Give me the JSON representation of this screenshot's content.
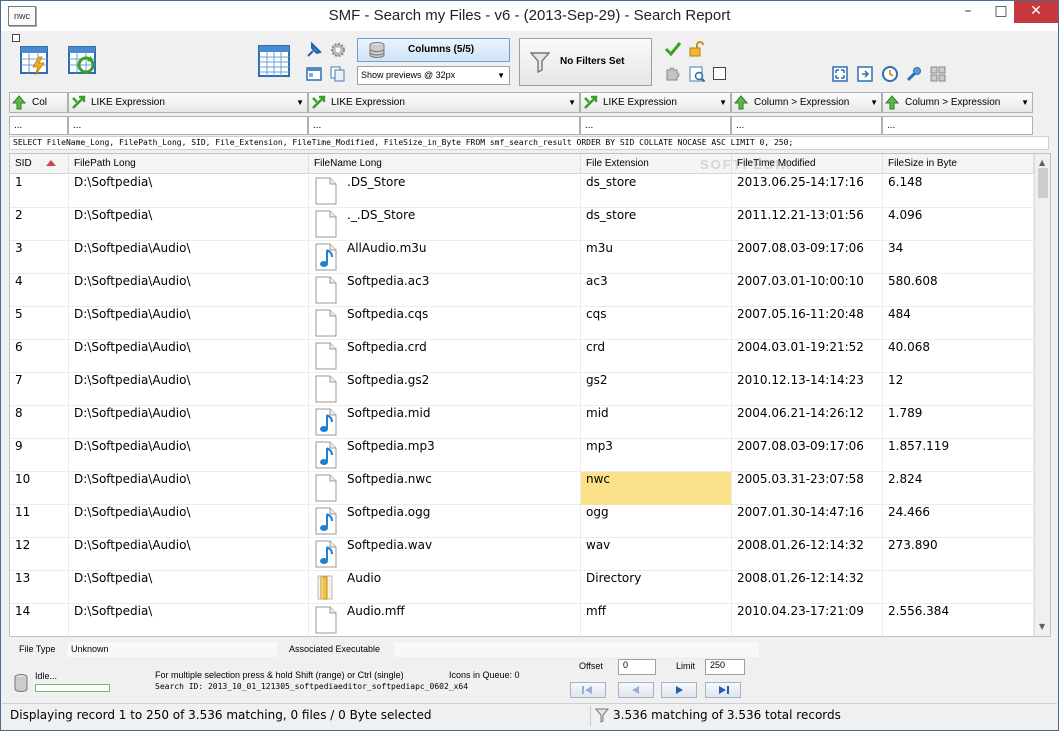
{
  "window": {
    "title": "SMF - Search my Files - v6 - (2013-Sep-29) - Search Report",
    "app_icon_label": "nwc",
    "minimize": "–",
    "maximize": "□",
    "close": "✕"
  },
  "toolbar": {
    "columns_label": "Columns (5/5)",
    "preview_select": "Show previews @ 32px",
    "filter_label": "No Filters Set"
  },
  "filters": [
    {
      "label": "Col",
      "kind": "col"
    },
    {
      "label": "LIKE Expression",
      "kind": "like"
    },
    {
      "label": "LIKE Expression",
      "kind": "like"
    },
    {
      "label": "LIKE Expression",
      "kind": "like"
    },
    {
      "label": "Column > Expression",
      "kind": "gt"
    },
    {
      "label": "Column > Expression",
      "kind": "gt"
    }
  ],
  "filter_values": [
    "...",
    "...",
    "...",
    "...",
    "...",
    "..."
  ],
  "sql": "SELECT FileName_Long, FilePath_Long, SID, File_Extension, FileTime_Modified, FileSize_in_Byte FROM smf_search_result ORDER BY SID COLLATE NOCASE ASC LIMIT 0, 250;",
  "columns": {
    "sid": "SID",
    "path": "FilePath Long",
    "name": "FileName Long",
    "ext": "File Extension",
    "time": "FileTime Modified",
    "size": "FileSize in Byte"
  },
  "watermark": "SOFTPEDIA",
  "rows": [
    {
      "sid": "1",
      "path": "D:\\Softpedia\\",
      "icon": "blank-file-icon",
      "name": ".DS_Store",
      "ext": "ds_store",
      "time": "2013.06.25-14:17:16",
      "size": "6.148"
    },
    {
      "sid": "2",
      "path": "D:\\Softpedia\\",
      "icon": "blank-file-icon",
      "name": "._.DS_Store",
      "ext": "ds_store",
      "time": "2011.12.21-13:01:56",
      "size": "4.096"
    },
    {
      "sid": "3",
      "path": "D:\\Softpedia\\Audio\\",
      "icon": "audio-file-icon",
      "name": "AllAudio.m3u",
      "ext": "m3u",
      "time": "2007.08.03-09:17:06",
      "size": "34"
    },
    {
      "sid": "4",
      "path": "D:\\Softpedia\\Audio\\",
      "icon": "blank-file-icon",
      "name": "Softpedia.ac3",
      "ext": "ac3",
      "time": "2007.03.01-10:00:10",
      "size": "580.608"
    },
    {
      "sid": "5",
      "path": "D:\\Softpedia\\Audio\\",
      "icon": "blank-file-icon",
      "name": "Softpedia.cqs",
      "ext": "cqs",
      "time": "2007.05.16-11:20:48",
      "size": "484"
    },
    {
      "sid": "6",
      "path": "D:\\Softpedia\\Audio\\",
      "icon": "blank-file-icon",
      "name": "Softpedia.crd",
      "ext": "crd",
      "time": "2004.03.01-19:21:52",
      "size": "40.068"
    },
    {
      "sid": "7",
      "path": "D:\\Softpedia\\Audio\\",
      "icon": "blank-file-icon",
      "name": "Softpedia.gs2",
      "ext": "gs2",
      "time": "2010.12.13-14:14:23",
      "size": "12"
    },
    {
      "sid": "8",
      "path": "D:\\Softpedia\\Audio\\",
      "icon": "audio-file-icon",
      "name": "Softpedia.mid",
      "ext": "mid",
      "time": "2004.06.21-14:26:12",
      "size": "1.789"
    },
    {
      "sid": "9",
      "path": "D:\\Softpedia\\Audio\\",
      "icon": "audio-file-icon",
      "name": "Softpedia.mp3",
      "ext": "mp3",
      "time": "2007.08.03-09:17:06",
      "size": "1.857.119"
    },
    {
      "sid": "10",
      "path": "D:\\Softpedia\\Audio\\",
      "icon": "blank-file-icon",
      "name": "Softpedia.nwc",
      "ext": "nwc",
      "time": "2005.03.31-23:07:58",
      "size": "2.824",
      "highlight": "ext"
    },
    {
      "sid": "11",
      "path": "D:\\Softpedia\\Audio\\",
      "icon": "audio-file-icon",
      "name": "Softpedia.ogg",
      "ext": "ogg",
      "time": "2007.01.30-14:47:16",
      "size": "24.466"
    },
    {
      "sid": "12",
      "path": "D:\\Softpedia\\Audio\\",
      "icon": "audio-file-icon",
      "name": "Softpedia.wav",
      "ext": "wav",
      "time": "2008.01.26-12:14:32",
      "size": "273.890"
    },
    {
      "sid": "13",
      "path": "D:\\Softpedia\\",
      "icon": "folder-icon",
      "name": "Audio",
      "ext": "Directory",
      "time": "2008.01.26-12:14:32",
      "size": ""
    },
    {
      "sid": "14",
      "path": "D:\\Softpedia\\",
      "icon": "blank-file-icon",
      "name": "Audio.mff",
      "ext": "mff",
      "time": "2010.04.23-17:21:09",
      "size": "2.556.384"
    }
  ],
  "info": {
    "file_type_label": "File Type",
    "file_type_value": "Unknown",
    "assoc_label": "Associated Executable",
    "assoc_value": ""
  },
  "bottom": {
    "idle": "Idle...",
    "hint": "For multiple selection press & hold Shift (range) or Ctrl (single)",
    "icons_queue": "Icons in Queue:  0",
    "search_id": "Search ID: 2013_10_01_121305_softpediaeditor_softpediapc_0602_x64",
    "offset_label": "Offset",
    "offset_value": "0",
    "limit_label": "Limit",
    "limit_value": "250"
  },
  "status": {
    "left": "Displaying record 1 to 250 of 3.536 matching, 0 files / 0 Byte selected",
    "right": "3.536 matching of 3.536 total records"
  },
  "colors": {
    "highlight": "#fbe28a",
    "close_button": "#c7383e",
    "sort_arrow": "#d5405a"
  }
}
